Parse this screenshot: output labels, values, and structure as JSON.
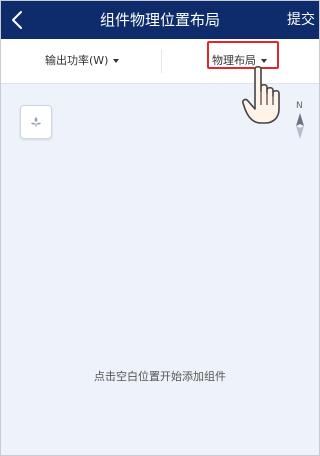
{
  "header": {
    "title": "组件物理位置布局",
    "submit_label": "提交"
  },
  "toolbar": {
    "power_label": "输出功率(W)",
    "layout_label": "物理布局"
  },
  "canvas": {
    "hint": "点击空白位置开始添加组件",
    "compass_label": "N"
  },
  "colors": {
    "header_bg": "#0e2c6b",
    "highlight": "#e3262e",
    "canvas_bg": "#eef2fa"
  }
}
